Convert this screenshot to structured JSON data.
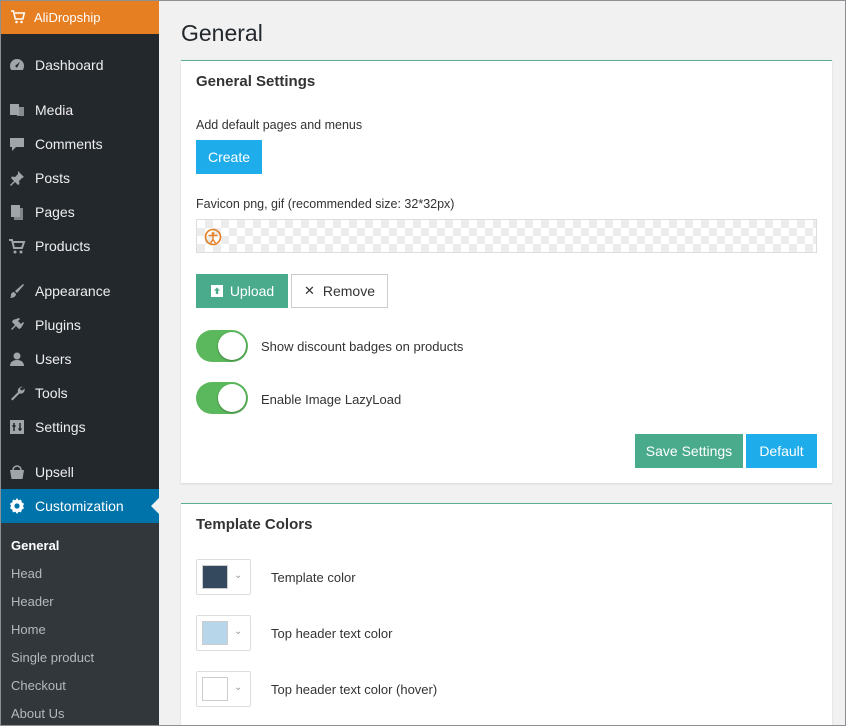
{
  "brand": {
    "label": "AliDropship",
    "icon": "cart-icon"
  },
  "sidebar": {
    "items": [
      {
        "label": "Dashboard",
        "icon": "dashboard-icon"
      },
      {
        "label": "Media",
        "icon": "media-icon"
      },
      {
        "label": "Comments",
        "icon": "comment-icon"
      },
      {
        "label": "Posts",
        "icon": "pin-icon"
      },
      {
        "label": "Pages",
        "icon": "pages-icon"
      },
      {
        "label": "Products",
        "icon": "cart-icon"
      },
      {
        "label": "Appearance",
        "icon": "brush-icon"
      },
      {
        "label": "Plugins",
        "icon": "plugin-icon"
      },
      {
        "label": "Users",
        "icon": "user-icon"
      },
      {
        "label": "Tools",
        "icon": "wrench-icon"
      },
      {
        "label": "Settings",
        "icon": "settings-icon"
      },
      {
        "label": "Upsell",
        "icon": "basket-icon"
      },
      {
        "label": "Customization",
        "icon": "gear-icon"
      }
    ],
    "submenu": [
      "General",
      "Head",
      "Header",
      "Home",
      "Single product",
      "Checkout",
      "About Us"
    ]
  },
  "page": {
    "title": "General"
  },
  "general_settings": {
    "title": "General Settings",
    "default_pages_label": "Add default pages and menus",
    "create_button": "Create",
    "favicon_label": "Favicon png, gif (recommended size: 32*32px)",
    "upload_button": "Upload",
    "remove_button": "Remove",
    "toggle_discount_label": "Show discount badges on products",
    "toggle_discount_on": true,
    "toggle_lazyload_label": "Enable Image LazyLoad",
    "toggle_lazyload_on": true,
    "save_button": "Save Settings",
    "default_button": "Default"
  },
  "template_colors": {
    "title": "Template Colors",
    "items": [
      {
        "label": "Template color",
        "color": "#34495e"
      },
      {
        "label": "Top header text color",
        "color": "#b8d6ea"
      },
      {
        "label": "Top header text color (hover)",
        "color": "#ffffff"
      }
    ]
  },
  "colors": {
    "brand": "#e67e22",
    "sidebar": "#23282d",
    "active": "#0073aa",
    "blue_button": "#1eacea",
    "green_button": "#4aab8c",
    "toggle_on": "#5cb85c"
  }
}
